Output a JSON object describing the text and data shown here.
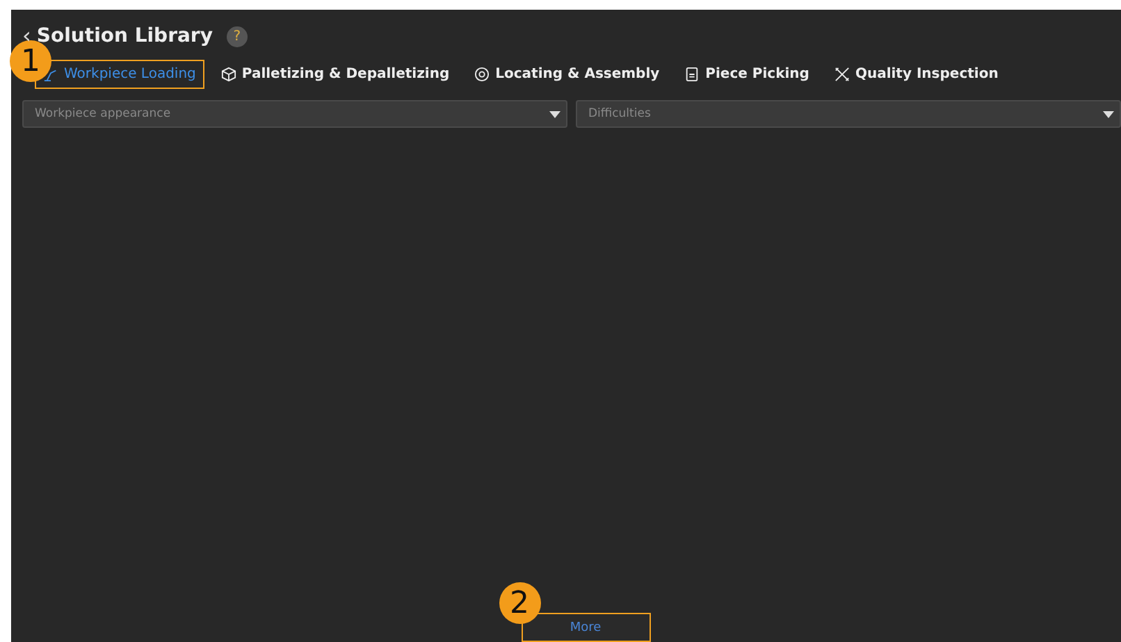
{
  "header": {
    "back": "‹",
    "title": "Solution Library",
    "help": "?"
  },
  "tabs": [
    {
      "label": "Workpiece Loading",
      "kind": "arm",
      "selected": true,
      "callout": "1"
    },
    {
      "label": "Palletizing & Depalletizing",
      "kind": "box",
      "selected": false
    },
    {
      "label": "Locating & Assembly",
      "kind": "gear",
      "selected": false
    },
    {
      "label": "Piece Picking",
      "kind": "bin",
      "selected": false
    },
    {
      "label": "Quality Inspection",
      "kind": "tools",
      "selected": false
    }
  ],
  "filters": [
    {
      "placeholder": "Workpiece appearance"
    },
    {
      "placeholder": "Difficulties"
    }
  ],
  "more_button": {
    "label": "More",
    "callout": "2"
  }
}
